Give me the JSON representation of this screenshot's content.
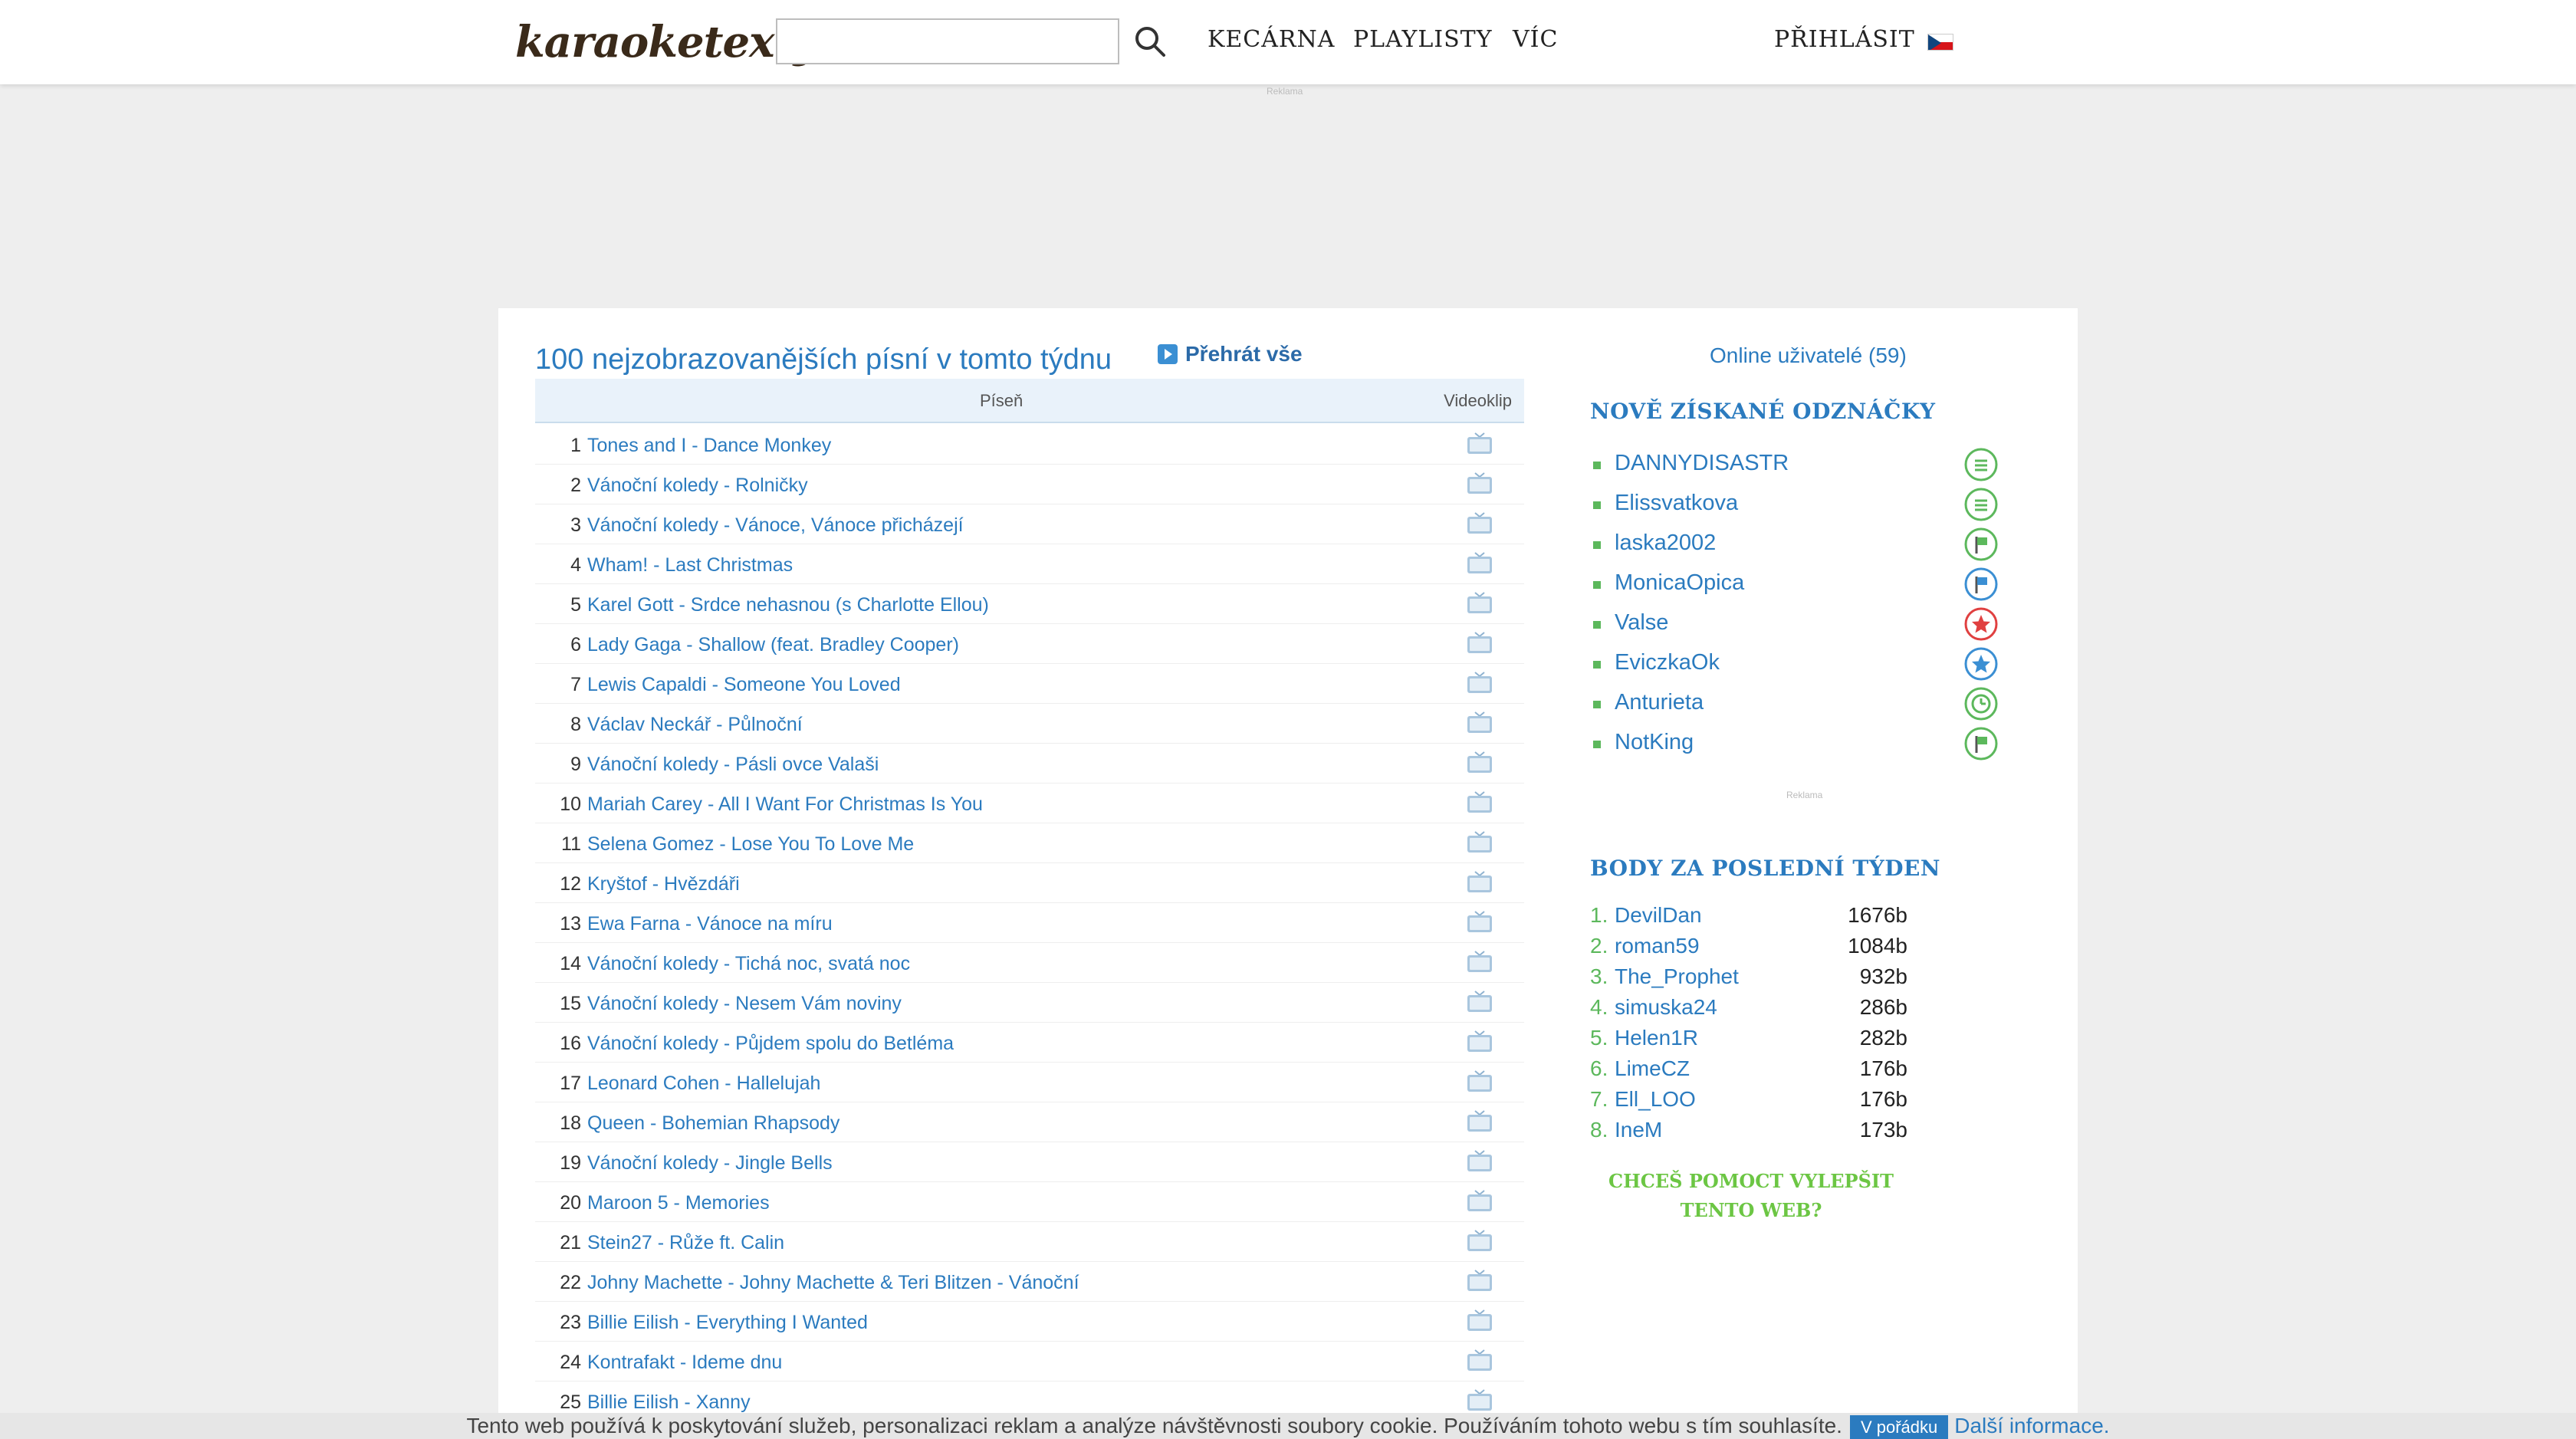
{
  "header": {
    "logo_text": "karaoketexty",
    "search": {
      "value": "",
      "placeholder": ""
    },
    "nav": [
      "KECÁRNA",
      "PLAYLISTY",
      "VÍC"
    ],
    "login": "PŘIHLÁSIT",
    "ad_label": "Reklama"
  },
  "main": {
    "title": "100 nejzobrazovanějších písní v tomto týdnu",
    "play_all": "Přehrát vše",
    "columns": {
      "song": "Píseň",
      "video": "Videoklip"
    },
    "rows": [
      {
        "num": "1",
        "song": "Tones and I - Dance Monkey"
      },
      {
        "num": "2",
        "song": "Vánoční koledy - Rolničky"
      },
      {
        "num": "3",
        "song": "Vánoční koledy - Vánoce, Vánoce přicházejí"
      },
      {
        "num": "4",
        "song": "Wham! - Last Christmas"
      },
      {
        "num": "5",
        "song": "Karel Gott - Srdce nehasnou (s Charlotte Ellou)"
      },
      {
        "num": "6",
        "song": "Lady Gaga - Shallow (feat. Bradley Cooper)"
      },
      {
        "num": "7",
        "song": "Lewis Capaldi - Someone You Loved"
      },
      {
        "num": "8",
        "song": "Václav Neckář - Půlnoční"
      },
      {
        "num": "9",
        "song": "Vánoční koledy - Pásli ovce Valaši"
      },
      {
        "num": "10",
        "song": "Mariah Carey - All I Want For Christmas Is You"
      },
      {
        "num": "11",
        "song": "Selena Gomez - Lose You To Love Me"
      },
      {
        "num": "12",
        "song": "Kryštof - Hvězdáři"
      },
      {
        "num": "13",
        "song": "Ewa Farna - Vánoce na míru"
      },
      {
        "num": "14",
        "song": "Vánoční koledy - Tichá noc, svatá noc"
      },
      {
        "num": "15",
        "song": "Vánoční koledy - Nesem Vám noviny"
      },
      {
        "num": "16",
        "song": "Vánoční koledy - Půjdem spolu do Betléma"
      },
      {
        "num": "17",
        "song": "Leonard Cohen - Hallelujah"
      },
      {
        "num": "18",
        "song": "Queen - Bohemian Rhapsody"
      },
      {
        "num": "19",
        "song": "Vánoční koledy - Jingle Bells"
      },
      {
        "num": "20",
        "song": "Maroon 5 - Memories"
      },
      {
        "num": "21",
        "song": "Stein27 - Růže ft. Calin"
      },
      {
        "num": "22",
        "song": "Johny Machette - Johny Machette & Teri Blitzen - Vánoční"
      },
      {
        "num": "23",
        "song": "Billie Eilish - Everything I Wanted"
      },
      {
        "num": "24",
        "song": "Kontrafakt - Ideme dnu"
      },
      {
        "num": "25",
        "song": "Billie Eilish - Xanny"
      }
    ]
  },
  "sidebar": {
    "online": "Online uživatelé (59)",
    "badges_heading": "NOVĚ ZÍSKANÉ ODZNÁČKY",
    "badges": [
      {
        "user": "DANNYDISASTR",
        "icon": "list-badge-icon",
        "color": "#5cb85c"
      },
      {
        "user": "Elissvatkova",
        "icon": "list-badge-icon",
        "color": "#5cb85c"
      },
      {
        "user": "laska2002",
        "icon": "flag-badge-icon",
        "color": "#5cb85c"
      },
      {
        "user": "MonicaOpica",
        "icon": "flag-badge-icon",
        "color": "#3b8fd3"
      },
      {
        "user": "Valse",
        "icon": "star-badge-icon",
        "color": "#e04040"
      },
      {
        "user": "EviczkaOk",
        "icon": "star-badge-icon",
        "color": "#3b8fd3"
      },
      {
        "user": "Anturieta",
        "icon": "clock-badge-icon",
        "color": "#5cb85c"
      },
      {
        "user": "NotKing",
        "icon": "flag-badge-icon",
        "color": "#5cb85c"
      }
    ],
    "ad_label": "Reklama",
    "points_heading": "BODY ZA POSLEDNÍ TÝDEN",
    "points": [
      {
        "rank": "1.",
        "user": "DevilDan",
        "pts": "1676b"
      },
      {
        "rank": "2.",
        "user": "roman59",
        "pts": "1084b"
      },
      {
        "rank": "3.",
        "user": "The_Prophet",
        "pts": "932b"
      },
      {
        "rank": "4.",
        "user": "simuska24",
        "pts": "286b"
      },
      {
        "rank": "5.",
        "user": "Helen1R",
        "pts": "282b"
      },
      {
        "rank": "6.",
        "user": "LimeCZ",
        "pts": "176b"
      },
      {
        "rank": "7.",
        "user": "Ell_LOO",
        "pts": "176b"
      },
      {
        "rank": "8.",
        "user": "IneM",
        "pts": "173b"
      }
    ],
    "help": "CHCEŠ POMOCT VYLEPŠIT TENTO WEB?"
  },
  "cookie": {
    "text": "Tento web používá k poskytování služeb, personalizaci reklam a analýze návštěvnosti soubory cookie. Používáním tohoto webu s tím souhlasíte.",
    "ok": "V pořádku",
    "more": "Další informace."
  },
  "colors": {
    "accent": "#2b7bbf",
    "green": "#5cb85c"
  }
}
